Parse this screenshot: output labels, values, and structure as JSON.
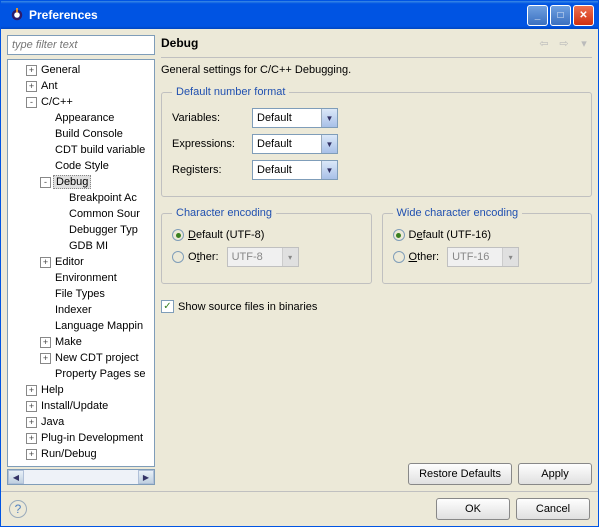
{
  "window": {
    "title": "Preferences"
  },
  "filter": {
    "placeholder": "type filter text"
  },
  "tree": {
    "items": [
      {
        "label": "General",
        "level": 1,
        "exp": "+"
      },
      {
        "label": "Ant",
        "level": 1,
        "exp": "+"
      },
      {
        "label": "C/C++",
        "level": 1,
        "exp": "-"
      },
      {
        "label": "Appearance",
        "level": 2,
        "exp": ""
      },
      {
        "label": "Build Console",
        "level": 2,
        "exp": ""
      },
      {
        "label": "CDT build variable",
        "level": 2,
        "exp": ""
      },
      {
        "label": "Code Style",
        "level": 2,
        "exp": ""
      },
      {
        "label": "Debug",
        "level": 2,
        "exp": "-",
        "selected": true
      },
      {
        "label": "Breakpoint Ac",
        "level": 3,
        "exp": ""
      },
      {
        "label": "Common Sour",
        "level": 3,
        "exp": ""
      },
      {
        "label": "Debugger Typ",
        "level": 3,
        "exp": ""
      },
      {
        "label": "GDB MI",
        "level": 3,
        "exp": ""
      },
      {
        "label": "Editor",
        "level": 2,
        "exp": "+"
      },
      {
        "label": "Environment",
        "level": 2,
        "exp": ""
      },
      {
        "label": "File Types",
        "level": 2,
        "exp": ""
      },
      {
        "label": "Indexer",
        "level": 2,
        "exp": ""
      },
      {
        "label": "Language Mappin",
        "level": 2,
        "exp": ""
      },
      {
        "label": "Make",
        "level": 2,
        "exp": "+"
      },
      {
        "label": "New CDT project",
        "level": 2,
        "exp": "+"
      },
      {
        "label": "Property Pages se",
        "level": 2,
        "exp": ""
      },
      {
        "label": "Help",
        "level": 1,
        "exp": "+"
      },
      {
        "label": "Install/Update",
        "level": 1,
        "exp": "+"
      },
      {
        "label": "Java",
        "level": 1,
        "exp": "+"
      },
      {
        "label": "Plug-in Development",
        "level": 1,
        "exp": "+"
      },
      {
        "label": "Run/Debug",
        "level": 1,
        "exp": "+"
      }
    ]
  },
  "page": {
    "title": "Debug",
    "desc": "General settings for C/C++ Debugging.",
    "numfmt": {
      "legend": "Default number format",
      "variables_label": "Variables:",
      "variables_value": "Default",
      "expressions_label": "Expressions:",
      "expressions_value": "Default",
      "registers_label": "Registers:",
      "registers_value": "Default"
    },
    "enc": {
      "legend": "Character encoding",
      "default_label": "Default (UTF-8)",
      "other_label": "Other:",
      "other_value": "UTF-8"
    },
    "wenc": {
      "legend": "Wide character encoding",
      "default_label": "Default (UTF-16)",
      "other_label": "Other:",
      "other_value": "UTF-16"
    },
    "show_src": "Show source files in binaries"
  },
  "buttons": {
    "restore": "Restore Defaults",
    "apply": "Apply",
    "ok": "OK",
    "cancel": "Cancel"
  }
}
